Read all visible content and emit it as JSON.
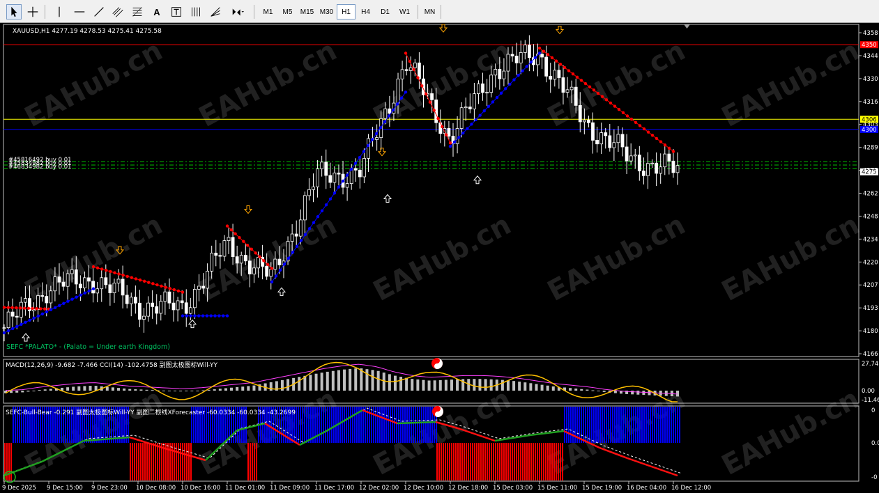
{
  "toolbar": {
    "tools": [
      {
        "name": "cursor-tool",
        "icon": "cursor-icon"
      },
      {
        "name": "crosshair-tool",
        "icon": "crosshair-icon"
      },
      {
        "name": "vertical-line-tool",
        "icon": "vertical-line-icon"
      },
      {
        "name": "horizontal-line-tool",
        "icon": "horizontal-line-icon"
      },
      {
        "name": "trendline-tool",
        "icon": "trendline-icon"
      },
      {
        "name": "equidistant-channel-tool",
        "icon": "channel-icon"
      },
      {
        "name": "fibonacci-tool",
        "icon": "fibonacci-icon"
      },
      {
        "name": "text-tool",
        "icon": "text-icon"
      },
      {
        "name": "text-label-tool",
        "icon": "text-label-icon"
      },
      {
        "name": "gann-tool",
        "icon": "gann-icon"
      },
      {
        "name": "fibo-fan-tool",
        "icon": "fibo-fan-icon"
      },
      {
        "name": "arrows-tool",
        "icon": "arrows-icon"
      }
    ],
    "text_tool_label": "A",
    "timeframes": [
      "M1",
      "M5",
      "M15",
      "M30",
      "H1",
      "H4",
      "D1",
      "W1",
      "MN"
    ],
    "active_timeframe": "H1"
  },
  "main_chart": {
    "symbol_info": "XAUUSD,H1  4277.19 4278.53 4275.41 4275.58",
    "indicator_label": "SEFC *PALATO* - (Palato = Under earth Kingdom)",
    "order_labels": [
      "#45816492 buy 0.01",
      "#45834982 buy 0.01",
      "#46834982 buy 0.01"
    ],
    "price_ticks": [
      "4358",
      "4344",
      "4330",
      "4316",
      "4303",
      "4289",
      "4275",
      "4262",
      "4248",
      "4234",
      "4220",
      "4207",
      "4193",
      "4180",
      "4166"
    ],
    "price_tags": [
      {
        "text": "4350",
        "color": "#ff0000"
      },
      {
        "text": "4306",
        "color": "#ffff00"
      },
      {
        "text": "4300",
        "color": "#0000ff"
      },
      {
        "text": "4275",
        "color": "#ffffff"
      }
    ]
  },
  "macd_panel": {
    "label": "MACD(12,26,9) -9.682 -7.466  CCI(14) -102.4758  副图太极图标Will-YY",
    "ticks": [
      "27.74",
      "0.00",
      "-11.46"
    ]
  },
  "bull_bear_panel": {
    "label": "SEFC-Bull-Bear -0.291  副图太极图标Will-YY  副图二根线XForecaster -60.0334 -60.0334 -43.2699",
    "ticks": [
      "0",
      "0.00",
      "-0"
    ]
  },
  "time_axis": [
    "9 Dec 2025",
    "9 Dec 15:00",
    "9 Dec 23:00",
    "10 Dec 08:00",
    "10 Dec 16:00",
    "11 Dec 01:00",
    "11 Dec 09:00",
    "11 Dec 17:00",
    "12 Dec 02:00",
    "12 Dec 10:00",
    "12 Dec 18:00",
    "15 Dec 03:00",
    "15 Dec 11:00",
    "15 Dec 19:00",
    "16 Dec 04:00",
    "16 Dec 12:00"
  ],
  "watermark": "EAHub.cn",
  "colors": {
    "resistance_line": "#ff0000",
    "yellow_line": "#ffff00",
    "blue_line": "#0000ff",
    "order_line": "#00c000",
    "bull_histogram": "#0000ff",
    "bear_histogram": "#ff0000",
    "macd_histogram": "#c0c0c0",
    "signal_line": "#ffc000",
    "cci_line": "#ff40ff"
  },
  "chart_data": {
    "type": "candlestick",
    "symbol": "XAUUSD",
    "timeframe": "H1",
    "ylim": [
      4166,
      4362
    ],
    "horizontal_levels": {
      "red": 4350,
      "yellow": 4306,
      "blue": 4300,
      "green_orders": [
        4281,
        4279,
        4277
      ]
    },
    "close_anchors": {
      "x": [
        "9 Dec 2025",
        "9 Dec 15:00",
        "9 Dec 23:00",
        "10 Dec 08:00",
        "10 Dec 16:00",
        "11 Dec 01:00",
        "11 Dec 09:00",
        "11 Dec 17:00",
        "12 Dec 02:00",
        "12 Dec 10:00",
        "12 Dec 18:00",
        "15 Dec 03:00",
        "15 Dec 11:00",
        "15 Dec 19:00",
        "16 Dec 04:00",
        "16 Dec 12:00"
      ],
      "y": [
        4183,
        4207,
        4212,
        4196,
        4195,
        4232,
        4212,
        4272,
        4275,
        4340,
        4295,
        4336,
        4345,
        4305,
        4283,
        4276
      ]
    },
    "trailing_stop": {
      "red_segments": [
        {
          "from": "9 Dec 2025",
          "to": "9 Dec 15:00",
          "y": [
            4195,
            4194
          ]
        },
        {
          "from": "9 Dec 23:00",
          "to": "10 Dec 16:00",
          "y": [
            4219,
            4204
          ]
        },
        {
          "from": "11 Dec 01:00",
          "to": "11 Dec 09:00",
          "y": [
            4243,
            4218
          ]
        },
        {
          "from": "12 Dec 10:00",
          "to": "12 Dec 18:00",
          "y": [
            4345,
            4292
          ]
        },
        {
          "from": "15 Dec 11:00",
          "to": "16 Dec 12:00",
          "y": [
            4348,
            4287
          ]
        }
      ],
      "blue_segments": [
        {
          "from": "9 Dec 2025",
          "to": "9 Dec 23:00",
          "y": [
            4180,
            4206
          ]
        },
        {
          "from": "10 Dec 16:00",
          "to": "11 Dec 01:00",
          "y": [
            4190,
            4190
          ]
        },
        {
          "from": "11 Dec 09:00",
          "to": "12 Dec 10:00",
          "y": [
            4210,
            4322
          ]
        },
        {
          "from": "12 Dec 18:00",
          "to": "15 Dec 11:00",
          "y": [
            4290,
            4345
          ]
        }
      ]
    },
    "bull_bear_state": [
      "bear",
      "bull",
      "bear",
      "bull",
      "bear",
      "bull",
      "bear",
      "bull",
      "bear"
    ],
    "macd": {
      "values": [
        -3,
        -2,
        1,
        3,
        5,
        6,
        4,
        2,
        1,
        0,
        -1,
        0,
        2,
        4,
        6,
        10,
        14,
        18,
        22,
        25,
        27,
        24,
        18,
        14,
        12,
        13,
        14,
        14,
        13,
        11,
        8,
        5,
        3,
        1,
        -2,
        -4,
        -5,
        -6,
        -7
      ]
    }
  }
}
